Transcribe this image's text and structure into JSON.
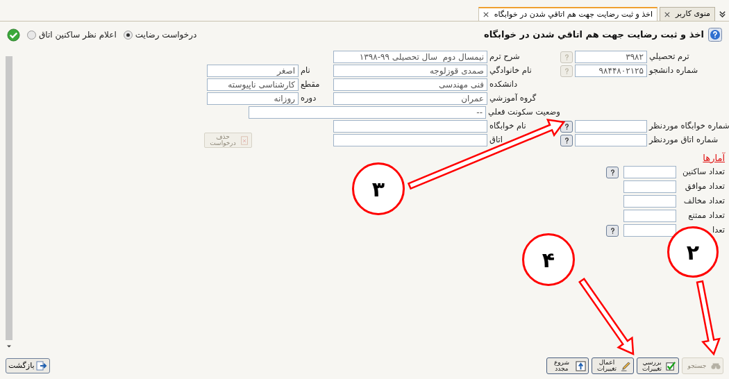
{
  "tabs": [
    {
      "label": "منوی کاربر",
      "selected": false
    },
    {
      "label": "اخذ و ثبت رضایت جهت هم اتاقي شدن در خوابگاه",
      "selected": true
    }
  ],
  "page_title": "اخذ و ثبت رضایت جهت هم اتاقي شدن در خوابگاه",
  "mode_options": [
    {
      "label": "درخواست رضایت",
      "selected": true
    },
    {
      "label": "اعلام نظر ساکنین اتاق",
      "selected": false
    }
  ],
  "form_rows": [
    {
      "right": {
        "label": "ترم تحصيلي",
        "value": "۳۹۸۲",
        "lookup_disabled": true
      },
      "middle": {
        "label": "شرح ترم",
        "value": "نيمسال دوم  سال تحصيلی ۹۹-۱۳۹۸"
      }
    },
    {
      "right": {
        "label": "شماره دانشجو",
        "value": "۹۸۴۴۸۰۲۱۲۵",
        "lookup_disabled": true
      },
      "middle": {
        "label": "نام خانوادگي",
        "value": "صمدی قوزلوجه"
      },
      "left": {
        "label": "نام",
        "value": "اصغر"
      }
    },
    {
      "middle": {
        "label": "دانشکده",
        "value": "فنی مهندسی"
      },
      "left": {
        "label": "مقطع",
        "value": "کارشناسی ناپیوسته"
      }
    },
    {
      "middle": {
        "label": "گروه آموزشي",
        "value": "عمران"
      },
      "left": {
        "label": "دوره",
        "value": "روزانه"
      }
    },
    {
      "wide": {
        "label": "وضعیت سکونت فعلي",
        "value": "--"
      }
    },
    {
      "right": {
        "label": "شماره خوابگاه موردنظر",
        "lookup_disabled": false
      },
      "middle": {
        "label": "نام خوابگاه"
      }
    },
    {
      "right": {
        "label": "شماره اتاق موردنظر",
        "lookup_disabled": false
      },
      "middle": {
        "label": "اتاق"
      },
      "action": {
        "label": "حذف درخواست",
        "disabled": true
      }
    }
  ],
  "stats_title": "آمارها",
  "stats": [
    {
      "label": "تعداد ساکنین",
      "lookup": true
    },
    {
      "label": "تعداد موافق",
      "lookup": false
    },
    {
      "label": "تعداد مخالف",
      "lookup": false
    },
    {
      "label": "تعداد ممتنع",
      "lookup": false
    },
    {
      "label": "تعدا",
      "lookup": true
    }
  ],
  "toolbar": [
    {
      "kind": "search",
      "label": "جستجو",
      "disabled": true
    },
    {
      "kind": "review",
      "label": "بررسي تغییرات",
      "disabled": false
    },
    {
      "kind": "apply",
      "label": "اعمال تغییرات",
      "disabled": false
    },
    {
      "kind": "restart",
      "label": "شروع مجدد",
      "disabled": false
    }
  ],
  "back_button": {
    "label": "بازگشت"
  },
  "annotations": [
    {
      "label": "۳"
    },
    {
      "label": "۴"
    },
    {
      "label": "۲"
    }
  ]
}
